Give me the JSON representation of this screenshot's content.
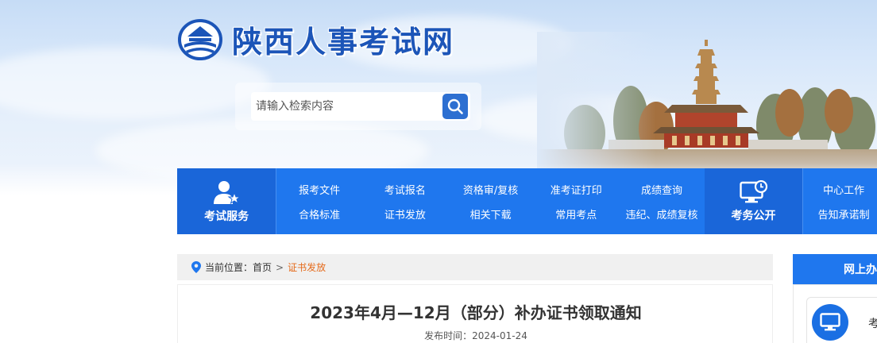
{
  "header": {
    "site_name": "陕西人事考试网",
    "logo_icon": "emblem-icon",
    "search": {
      "placeholder": "请输入检索内容",
      "icon": "search-icon"
    }
  },
  "nav": {
    "service": {
      "label": "考试服务",
      "icon": "user-star-icon"
    },
    "columns": [
      {
        "top": "报考文件",
        "bottom": "合格标准"
      },
      {
        "top": "考试报名",
        "bottom": "证书发放"
      },
      {
        "top": "资格审/复核",
        "bottom": "相关下载"
      },
      {
        "top": "准考证打印",
        "bottom": "常用考点"
      },
      {
        "top": "成绩查询",
        "bottom": "违纪、成绩复核"
      }
    ],
    "public": {
      "label": "考务公开",
      "icon": "monitor-clock-icon"
    },
    "right_column": {
      "top": "中心工作",
      "bottom": "告知承诺制"
    }
  },
  "breadcrumb": {
    "prefix": "当前位置：",
    "home": "首页",
    "separator": ">",
    "current": "证书发放",
    "icon": "location-pin-icon"
  },
  "article": {
    "title": "2023年4月—12月（部分）补办证书领取通知",
    "publish_time": "发布时间：2024-01-24"
  },
  "sidebar": {
    "heading": "网上办",
    "item_label": "考",
    "item_icon": "monitor-icon"
  },
  "colors": {
    "nav_blue": "#1f77ee",
    "nav_dark_blue": "#1a66d9",
    "breadcrumb_current": "#e56a1a",
    "site_name": "#1c55b8"
  }
}
